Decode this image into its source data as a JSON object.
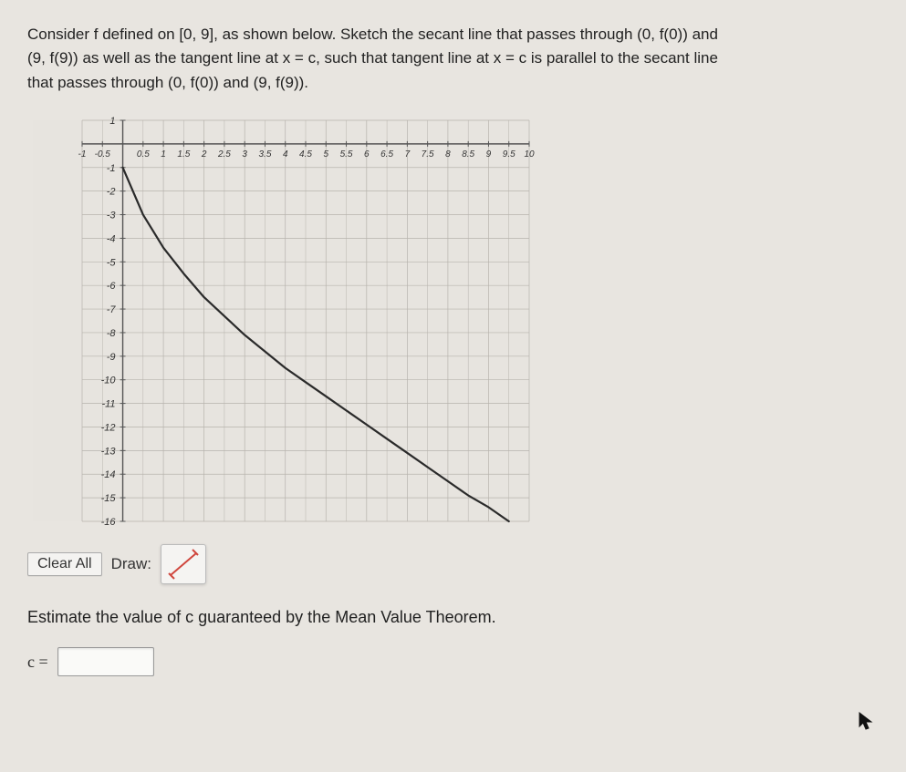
{
  "problem": {
    "line1": "Consider f defined on [0, 9], as shown below. Sketch the secant line that passes through (0, f(0)) and",
    "line2": "(9, f(9)) as well as the tangent line at x = c, such that tangent line at x = c is parallel to the secant line",
    "line3": "that passes through (0, f(0)) and (9, f(9))."
  },
  "toolbar": {
    "clear_label": "Clear All",
    "draw_label": "Draw:"
  },
  "estimate_text": "Estimate the value of c guaranteed by the Mean Value Theorem.",
  "answer_label": "c =",
  "chart_data": {
    "type": "line",
    "title": "",
    "xlabel": "",
    "ylabel": "",
    "xlim": [
      -1,
      10
    ],
    "ylim": [
      -16,
      1
    ],
    "xticks": [
      -1,
      -0.5,
      0,
      0.5,
      1,
      1.5,
      2,
      2.5,
      3,
      3.5,
      4,
      4.5,
      5,
      5.5,
      6,
      6.5,
      7,
      7.5,
      8,
      8.5,
      9,
      9.5,
      10
    ],
    "yticks": [
      1,
      -1,
      -2,
      -3,
      -4,
      -5,
      -6,
      -7,
      -8,
      -9,
      -10,
      -11,
      -12,
      -13,
      -14,
      -15,
      -16
    ],
    "series": [
      {
        "name": "f",
        "x": [
          0,
          0.5,
          1,
          1.5,
          2,
          2.5,
          3,
          3.5,
          4,
          4.5,
          5,
          5.5,
          6,
          6.5,
          7,
          7.5,
          8,
          8.5,
          9,
          9.5
        ],
        "values": [
          -1.0,
          -3.0,
          -4.4,
          -5.5,
          -6.5,
          -7.3,
          -8.1,
          -8.8,
          -9.5,
          -10.1,
          -10.7,
          -11.3,
          -11.9,
          -12.5,
          -13.1,
          -13.7,
          -14.3,
          -14.9,
          -15.4,
          -16.0
        ]
      }
    ]
  }
}
